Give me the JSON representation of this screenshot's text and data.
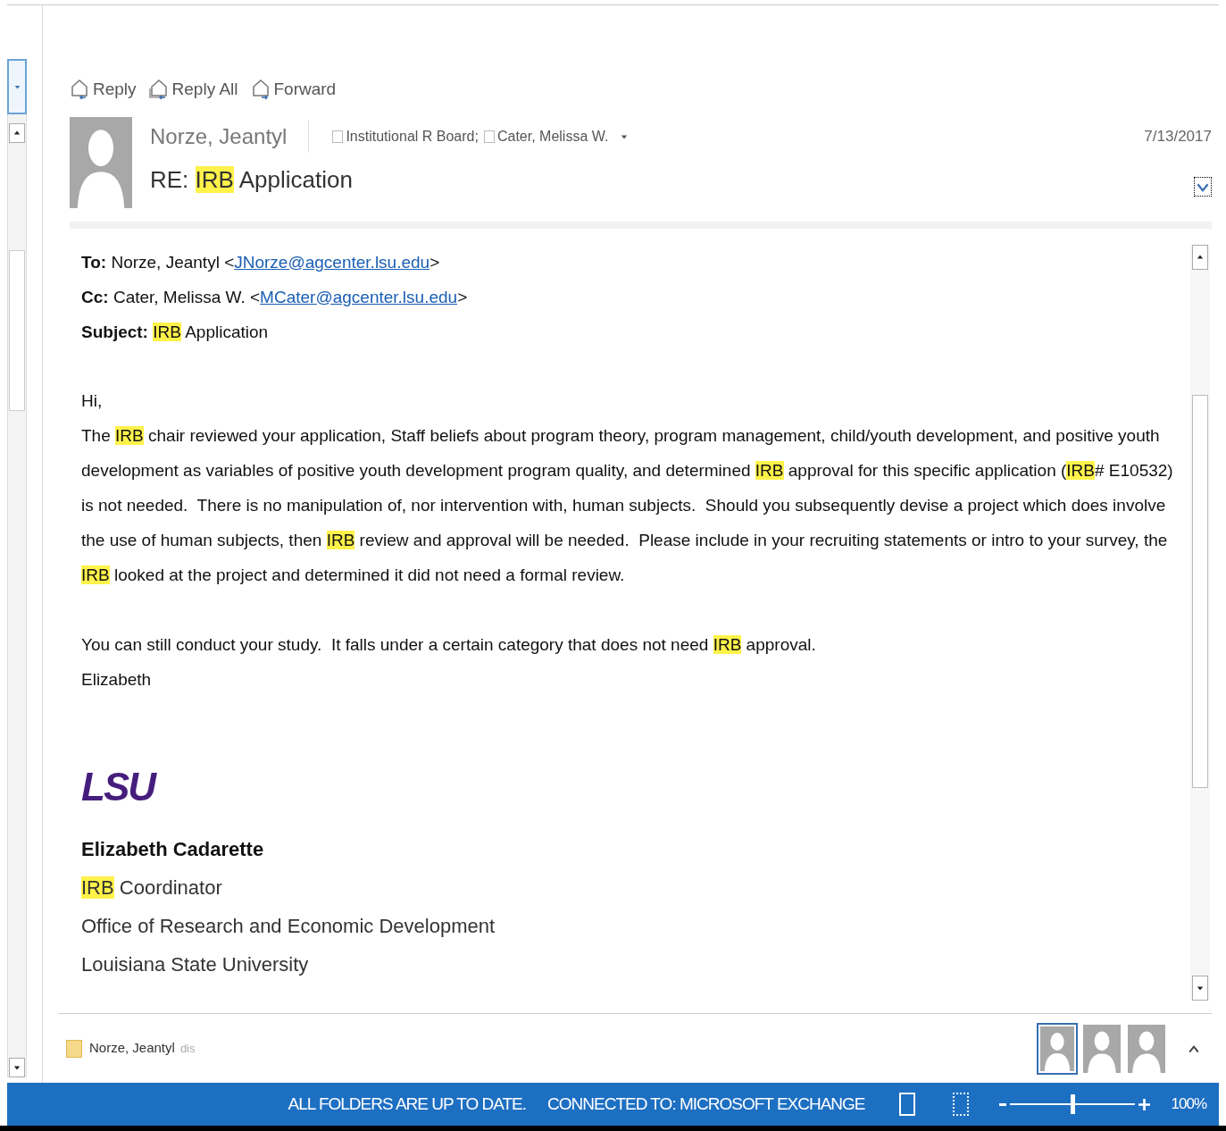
{
  "toolbar": [
    {
      "kind": "reply",
      "label": "Reply"
    },
    {
      "kind": "reply_all",
      "label": "Reply All"
    },
    {
      "kind": "forward",
      "label": "Forward"
    }
  ],
  "header": {
    "sender": "Norze, Jeantyl",
    "recipients": [
      "Institutional R Board;",
      "Cater, Melissa W."
    ],
    "date": "7/13/2017",
    "subject": [
      {
        "kind": "plain",
        "text": "RE: "
      },
      {
        "kind": "highlight",
        "text": "IRB"
      },
      {
        "kind": "plain",
        "text": " Application"
      }
    ]
  },
  "quoted_header": [
    [
      {
        "kind": "bold",
        "text": "To:"
      },
      {
        "kind": "plain",
        "text": " Norze, Jeantyl <"
      },
      {
        "kind": "link",
        "text": "JNorze@agcenter.lsu.edu"
      },
      {
        "kind": "plain",
        "text": ">"
      }
    ],
    [
      {
        "kind": "bold",
        "text": "Cc:"
      },
      {
        "kind": "plain",
        "text": " Cater, Melissa W. <"
      },
      {
        "kind": "link",
        "text": "MCater@agcenter.lsu.edu"
      },
      {
        "kind": "plain",
        "text": ">"
      }
    ],
    [
      {
        "kind": "bold",
        "text": "Subject: "
      },
      {
        "kind": "highlight",
        "text": "IRB"
      },
      {
        "kind": "plain",
        "text": " Application"
      }
    ]
  ],
  "paragraphs": [
    [
      {
        "kind": "plain",
        "text": "Hi,"
      }
    ],
    [
      {
        "kind": "plain",
        "text": "The "
      },
      {
        "kind": "highlight",
        "text": "IRB"
      },
      {
        "kind": "plain",
        "text": " chair reviewed your application, Staff beliefs about program theory, program management, child/youth development, and positive youth development as variables of positive youth development program quality, and determined "
      },
      {
        "kind": "highlight",
        "text": "IRB"
      },
      {
        "kind": "plain",
        "text": " approval for this specific application ("
      },
      {
        "kind": "highlight",
        "text": "IRB"
      },
      {
        "kind": "plain",
        "text": "# E10532) is not needed.  There is no manipulation of, nor intervention with, human subjects.  Should you subsequently devise a project which does involve the use of human subjects, then "
      },
      {
        "kind": "highlight",
        "text": "IRB"
      },
      {
        "kind": "plain",
        "text": " review and approval will be needed.  Please include in your recruiting statements or intro to your survey, the "
      },
      {
        "kind": "highlight",
        "text": "IRB"
      },
      {
        "kind": "plain",
        "text": " looked at the project and determined it did not need a formal review."
      }
    ],
    [
      {
        "kind": "plain",
        "text": "You can still conduct your study.  It falls under a certain category that does not need "
      },
      {
        "kind": "highlight",
        "text": "IRB"
      },
      {
        "kind": "plain",
        "text": " approval."
      }
    ],
    [
      {
        "kind": "plain",
        "text": "Elizabeth"
      }
    ]
  ],
  "signature": {
    "logo": "LSU",
    "name": "Elizabeth Cadarette",
    "lines": [
      [
        {
          "kind": "highlight",
          "text": "IRB"
        },
        {
          "kind": "plain",
          "text": " Coordinator"
        }
      ],
      [
        {
          "kind": "plain",
          "text": "Office of Research and Economic Development"
        }
      ],
      [
        {
          "kind": "plain",
          "text": "Louisiana State University"
        }
      ]
    ]
  },
  "people_pane": {
    "name": "Norze, Jeantyl",
    "note": "dis",
    "avatars": [
      {
        "selected": true
      },
      {
        "selected": false
      },
      {
        "selected": false
      }
    ]
  },
  "status_bar": {
    "items": [
      "ALL FOLDERS ARE UP TO DATE.",
      "CONNECTED TO: MICROSOFT EXCHANGE"
    ],
    "zoom": {
      "level": 0.5,
      "label": "100%"
    }
  }
}
